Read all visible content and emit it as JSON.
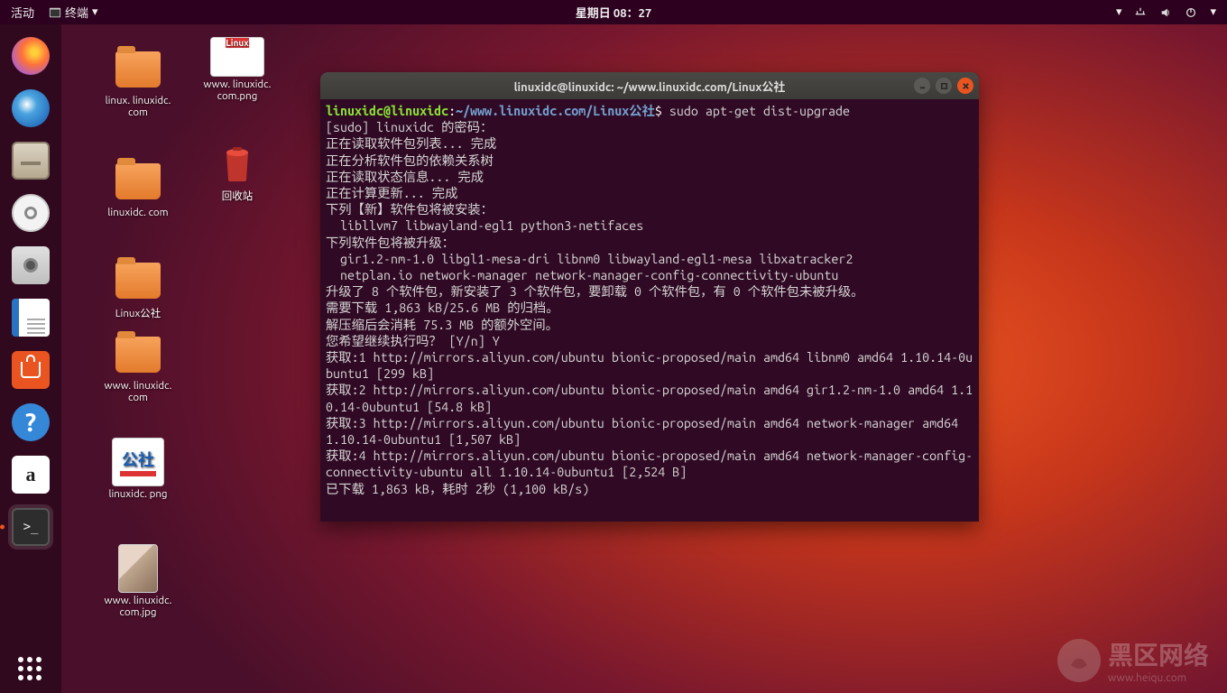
{
  "topbar": {
    "activities": "活动",
    "app_indicator": "终端",
    "clock": "星期日 08：27"
  },
  "dock": {
    "items": [
      {
        "name": "firefox",
        "color": "#ff7139"
      },
      {
        "name": "thunderbird",
        "color": "#1f6fd0"
      },
      {
        "name": "files",
        "color": "#cfc3b5"
      },
      {
        "name": "rhythmbox",
        "color": "#f3f3f3"
      },
      {
        "name": "shotwell",
        "color": "#e8e8e8"
      },
      {
        "name": "libreoffice-writer",
        "color": "#2a73c4"
      },
      {
        "name": "ubuntu-software",
        "color": "#e95420"
      },
      {
        "name": "help",
        "color": "#3587d7"
      },
      {
        "name": "amazon",
        "color": "#fff"
      },
      {
        "name": "terminal",
        "color": "#2d2d2d",
        "active": true
      }
    ]
  },
  "desktop_icons": {
    "col1": [
      {
        "label": "linux.\nlinuxidc.\ncom",
        "type": "folder"
      },
      {
        "label": "linuxidc.\ncom",
        "type": "folder"
      },
      {
        "label": "Linux公社",
        "type": "folder"
      },
      {
        "label": "www.\nlinuxidc.\ncom",
        "type": "folder"
      },
      {
        "label": "linuxidc.\npng",
        "type": "image-gs"
      },
      {
        "label": "www.\nlinuxidc.\ncom.jpg",
        "type": "image-photo"
      }
    ],
    "col2": [
      {
        "label": "www.\nlinuxidc.\ncom.png",
        "type": "image-linux"
      },
      {
        "label": "回收站",
        "type": "trash"
      }
    ]
  },
  "terminal": {
    "title": "linuxidc@linuxidc: ~/www.linuxidc.com/Linux公社",
    "prompt_user": "linuxidc@linuxidc",
    "prompt_colon": ":",
    "prompt_path": "~/www.linuxidc.com/Linux公社",
    "prompt_dollar": "$",
    "command": " sudo apt-get dist-upgrade",
    "lines": [
      "[sudo] linuxidc 的密码：",
      "正在读取软件包列表... 完成",
      "正在分析软件包的依赖关系树       ",
      "正在读取状态信息... 完成       ",
      "正在计算更新... 完成",
      "下列【新】软件包将被安装：",
      "  libllvm7 libwayland-egl1 python3-netifaces",
      "下列软件包将被升级：",
      "  gir1.2-nm-1.0 libgl1-mesa-dri libnm0 libwayland-egl1-mesa libxatracker2",
      "  netplan.io network-manager network-manager-config-connectivity-ubuntu",
      "升级了 8 个软件包，新安装了 3 个软件包，要卸载 0 个软件包，有 0 个软件包未被升级。",
      "需要下载 1,863 kB/25.6 MB 的归档。",
      "解压缩后会消耗 75.3 MB 的额外空间。",
      "您希望继续执行吗？ [Y/n] Y",
      "获取:1 http://mirrors.aliyun.com/ubuntu bionic-proposed/main amd64 libnm0 amd64 1.10.14-0ubuntu1 [299 kB]",
      "获取:2 http://mirrors.aliyun.com/ubuntu bionic-proposed/main amd64 gir1.2-nm-1.0 amd64 1.10.14-0ubuntu1 [54.8 kB]",
      "获取:3 http://mirrors.aliyun.com/ubuntu bionic-proposed/main amd64 network-manager amd64 1.10.14-0ubuntu1 [1,507 kB]",
      "获取:4 http://mirrors.aliyun.com/ubuntu bionic-proposed/main amd64 network-manager-config-connectivity-ubuntu all 1.10.14-0ubuntu1 [2,524 B]",
      "已下载 1,863 kB，耗时 2秒 (1,100 kB/s)"
    ]
  },
  "watermark": {
    "text": "黑区网络",
    "sub": "www.heiqu.com"
  }
}
